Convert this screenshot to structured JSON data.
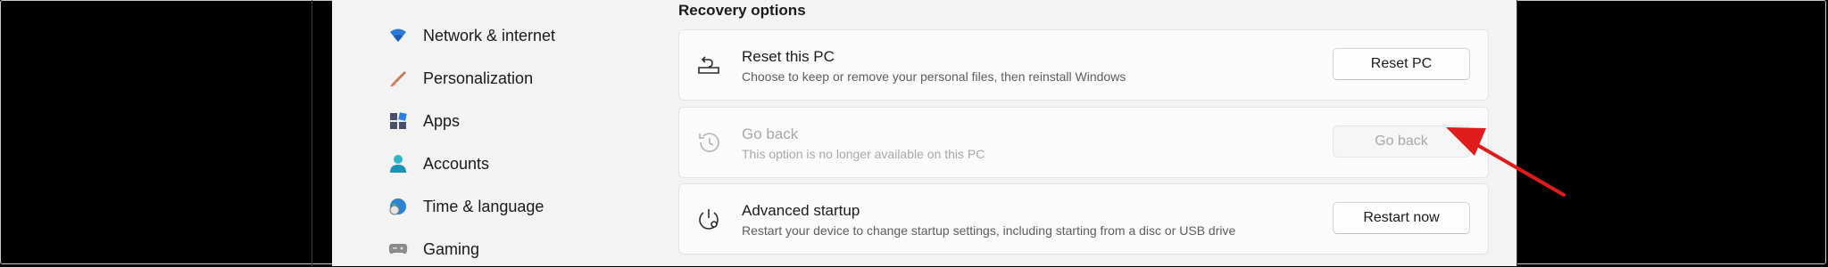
{
  "sidebar": {
    "items": [
      {
        "label": "Network & internet",
        "icon": "wifi-icon"
      },
      {
        "label": "Personalization",
        "icon": "brush-icon"
      },
      {
        "label": "Apps",
        "icon": "apps-icon"
      },
      {
        "label": "Accounts",
        "icon": "person-icon"
      },
      {
        "label": "Time & language",
        "icon": "globe-clock-icon"
      },
      {
        "label": "Gaming",
        "icon": "gamepad-icon"
      }
    ]
  },
  "recovery": {
    "section_title": "Recovery options",
    "reset": {
      "title": "Reset this PC",
      "subtitle": "Choose to keep or remove your personal files, then reinstall Windows",
      "button": "Reset PC"
    },
    "goback": {
      "title": "Go back",
      "subtitle": "This option is no longer available on this PC",
      "button": "Go back",
      "disabled": true
    },
    "advanced": {
      "title": "Advanced startup",
      "subtitle": "Restart your device to change startup settings, including starting from a disc or USB drive",
      "button": "Restart now"
    }
  },
  "colors": {
    "arrow": "#e01b1b",
    "window_bg": "#f3f3f3",
    "card_bg": "#fbfbfb"
  }
}
